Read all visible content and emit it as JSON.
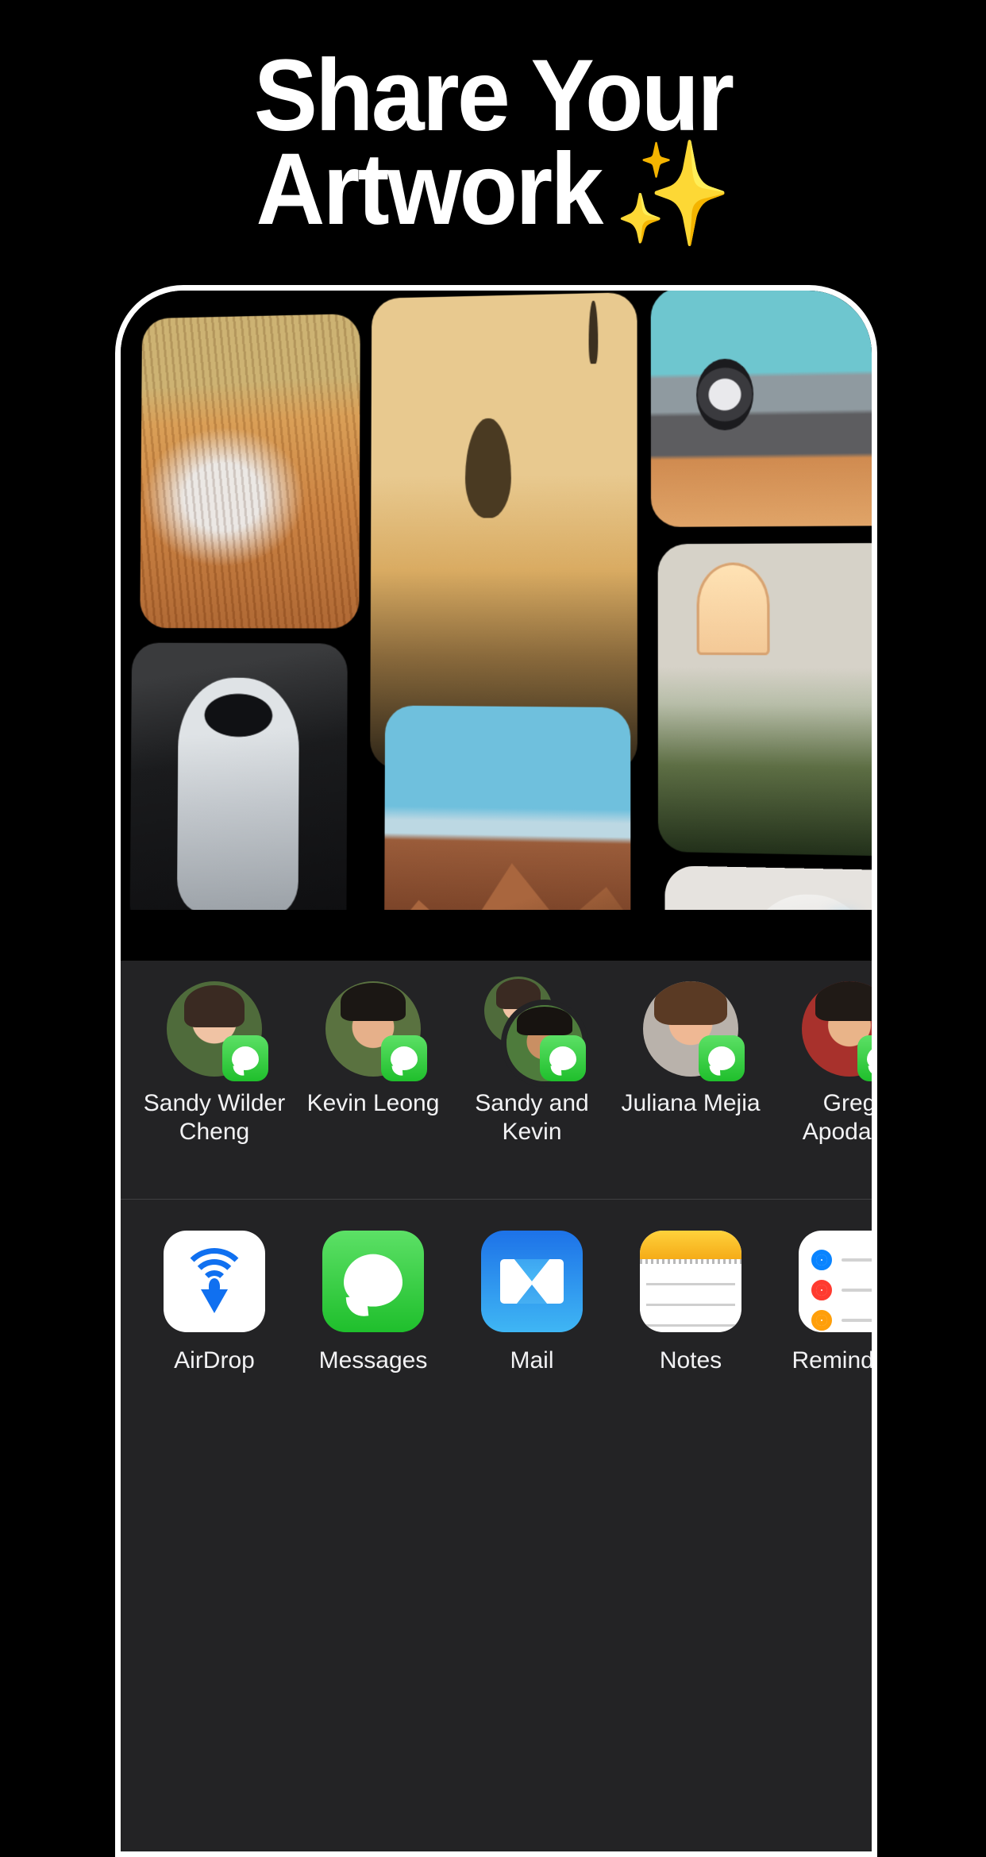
{
  "headline": {
    "line1": "Share Your",
    "line2": "Artwork",
    "emoji": "✨",
    "color": "#ffffff"
  },
  "theme": {
    "page_background": "#000000",
    "sheet_background": "#232325",
    "text_color": "#f2f2f4",
    "messages_green": "#1fbf2c",
    "airdrop_blue": "#1070f0",
    "mail_blue": "#1d72e8",
    "notes_yellow": "#ffd23c",
    "reminder_blue": "#0a84ff",
    "reminder_red": "#ff3b30",
    "reminder_orange": "#ff9f0a"
  },
  "share_sheet": {
    "contacts": [
      {
        "name": "Sandy Wilder Cheng",
        "badge": "messages-app-badge",
        "avatar": "avatar-sandy-wilder-cheng",
        "type": "single"
      },
      {
        "name": "Kevin Leong",
        "badge": "messages-app-badge",
        "avatar": "avatar-kevin-leong",
        "type": "single"
      },
      {
        "name": "Sandy and Kevin",
        "badge": "messages-app-badge",
        "avatar": "avatar-sandy-and-kevin",
        "type": "group"
      },
      {
        "name": "Juliana Mejia",
        "badge": "messages-app-badge",
        "avatar": "avatar-juliana-mejia",
        "type": "single"
      },
      {
        "name": "Greg Apodaca",
        "badge": "messages-app-badge",
        "avatar": "avatar-greg-apodaca",
        "type": "single"
      }
    ],
    "apps": [
      {
        "label": "AirDrop",
        "icon": "airdrop-icon"
      },
      {
        "label": "Messages",
        "icon": "messages-icon"
      },
      {
        "label": "Mail",
        "icon": "mail-icon"
      },
      {
        "label": "Notes",
        "icon": "notes-icon"
      },
      {
        "label": "Reminders",
        "icon": "reminders-icon"
      }
    ]
  },
  "photo_grid": {
    "tiles": [
      {
        "name": "hammock-desert-artwork"
      },
      {
        "name": "hot-air-balloons-temples-artwork"
      },
      {
        "name": "retro-van-road-artwork"
      },
      {
        "name": "astronaut-artwork"
      },
      {
        "name": "mountain-landscape-artwork"
      },
      {
        "name": "greenhouse-plants-artwork"
      },
      {
        "name": "blue-purple-forest-artwork"
      },
      {
        "name": "flying-whale-artwork"
      },
      {
        "name": "white-robot-artwork"
      }
    ]
  }
}
